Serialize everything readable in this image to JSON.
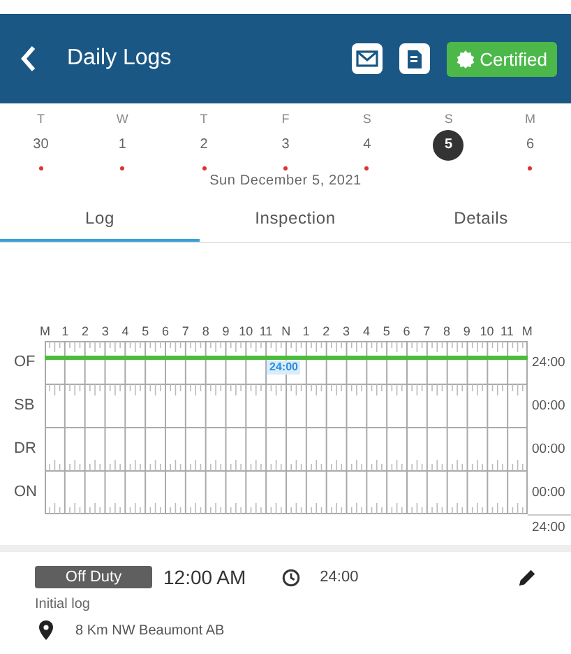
{
  "header": {
    "title": "Daily Logs",
    "certified_label": "Certified"
  },
  "week": [
    {
      "weekday": "T",
      "day": "30",
      "selected": false,
      "has_log": true
    },
    {
      "weekday": "W",
      "day": "1",
      "selected": false,
      "has_log": true
    },
    {
      "weekday": "T",
      "day": "2",
      "selected": false,
      "has_log": true
    },
    {
      "weekday": "F",
      "day": "3",
      "selected": false,
      "has_log": true
    },
    {
      "weekday": "S",
      "day": "4",
      "selected": false,
      "has_log": true
    },
    {
      "weekday": "S",
      "day": "5",
      "selected": true,
      "has_log": false
    },
    {
      "weekday": "M",
      "day": "6",
      "selected": false,
      "has_log": true
    }
  ],
  "date_label": "Sun December 5, 2021",
  "tabs": [
    {
      "label": "Log",
      "selected": true
    },
    {
      "label": "Inspection",
      "selected": false
    },
    {
      "label": "Details",
      "selected": false
    }
  ],
  "graph": {
    "hours": [
      "M",
      "1",
      "2",
      "3",
      "4",
      "5",
      "6",
      "7",
      "8",
      "9",
      "10",
      "11",
      "N",
      "1",
      "2",
      "3",
      "4",
      "5",
      "6",
      "7",
      "8",
      "9",
      "10",
      "11",
      "M"
    ],
    "rows": [
      {
        "label": "OF",
        "total": "24:00",
        "active": true
      },
      {
        "label": "SB",
        "total": "00:00",
        "active": false
      },
      {
        "label": "DR",
        "total": "00:00",
        "active": false
      },
      {
        "label": "ON",
        "total": "00:00",
        "active": false
      }
    ],
    "marker": "24:00",
    "grand_total": "24:00"
  },
  "entry": {
    "status": "Off Duty",
    "time": "12:00 AM",
    "duration": "24:00",
    "note": "Initial log",
    "location": "8 Km NW Beaumont AB"
  }
}
